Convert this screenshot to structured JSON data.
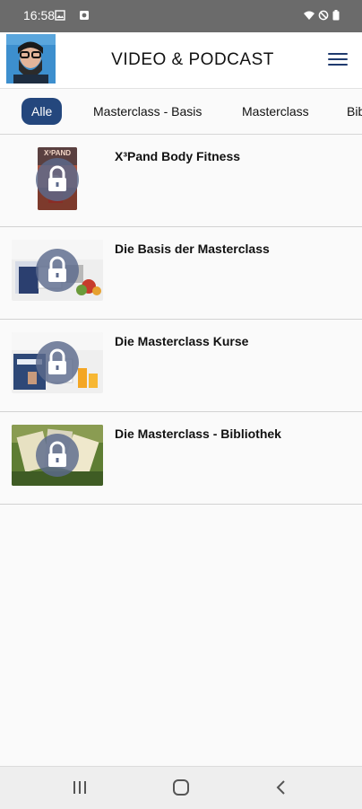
{
  "status_bar": {
    "time": "16:58"
  },
  "header": {
    "title": "VIDEO & PODCAST"
  },
  "tabs": [
    {
      "label": "Alle",
      "active": true
    },
    {
      "label": "Masterclass - Basis",
      "active": false
    },
    {
      "label": "Masterclass",
      "active": false
    },
    {
      "label": "Bibliothek",
      "active": false
    }
  ],
  "items": [
    {
      "title": "X³Pand Body Fitness",
      "thumb_text": "X³PAND",
      "locked": true
    },
    {
      "title": "Die Basis der Masterclass",
      "locked": true
    },
    {
      "title": "Die Masterclass Kurse",
      "locked": true
    },
    {
      "title": "Die Masterclass - Bibliothek",
      "locked": true
    }
  ],
  "colors": {
    "accent": "#24477d",
    "lock_overlay": "#5c6a8c",
    "status_bar": "#6b6b6b"
  },
  "icons": {
    "menu": "hamburger-icon",
    "lock": "lock-icon",
    "nav_recent": "recent-apps-icon",
    "nav_home": "home-icon",
    "nav_back": "back-icon"
  }
}
